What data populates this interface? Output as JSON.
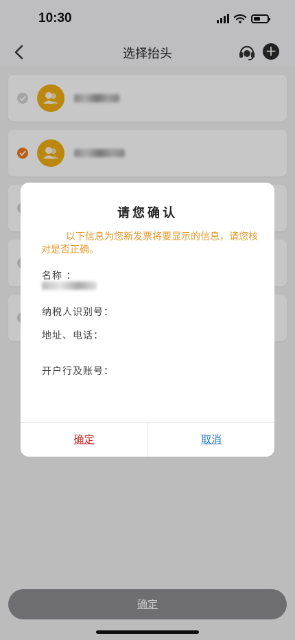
{
  "status": {
    "time": "10:30"
  },
  "nav": {
    "title": "选择抬头"
  },
  "list": {
    "items": [
      {
        "selected": false
      },
      {
        "selected": true
      },
      {
        "selected": false
      },
      {
        "selected": false
      },
      {
        "selected": false
      }
    ]
  },
  "footer": {
    "confirm_label": "确定"
  },
  "dialog": {
    "title": "请您确认",
    "notice": "以下信息为您新发票将要显示的信息，请您核对是否正确。",
    "fields": {
      "name": "名称 ：",
      "tax_id": "纳税人识别号：",
      "address_phone": "地址、电话：",
      "bank_account": "开户行及账号："
    },
    "confirm_label": "确定",
    "cancel_label": "取消"
  },
  "colors": {
    "accent": "#ef7a1a",
    "avatar": "#f0ad12",
    "notice": "#e49a2a",
    "confirm": "#c72a2a",
    "cancel": "#2a78c8"
  },
  "icons": [
    "back-arrow-icon",
    "headset-icon",
    "plus-icon",
    "checkmark-icon",
    "user-group-icon"
  ]
}
